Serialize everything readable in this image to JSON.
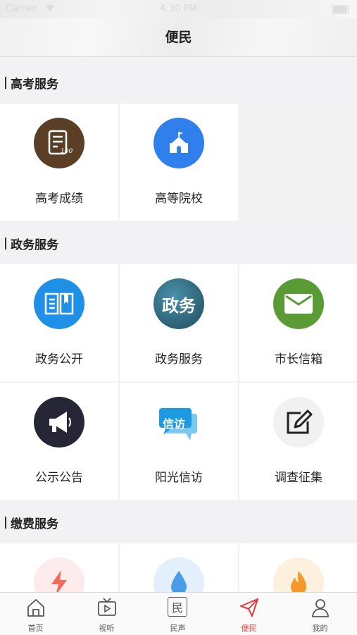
{
  "status_bar": {
    "carrier": "Carrier",
    "time": "4:30 PM"
  },
  "nav": {
    "title": "便民"
  },
  "sections": [
    {
      "title": "高考服务",
      "items": [
        {
          "label": "高考成绩",
          "icon": "exam-score-icon",
          "color": "#5b3e26"
        },
        {
          "label": "高等院校",
          "icon": "university-icon",
          "color": "#2f80ed"
        }
      ]
    },
    {
      "title": "政务服务",
      "items": [
        {
          "label": "政务公开",
          "icon": "open-book-icon",
          "color": "#1e90e8"
        },
        {
          "label": "政务服务",
          "icon": "gov-service-icon",
          "color": "#2f6f86",
          "text": "政务"
        },
        {
          "label": "市长信箱",
          "icon": "mail-icon",
          "color": "#5a9b36"
        },
        {
          "label": "公示公告",
          "icon": "megaphone-icon",
          "color": "#262636"
        },
        {
          "label": "阳光信访",
          "icon": "petition-chat-icon",
          "color": "#1e9be0",
          "text": "信访"
        },
        {
          "label": "调查征集",
          "icon": "edit-survey-icon",
          "color": "#f1f1f1"
        }
      ]
    },
    {
      "title": "缴费服务",
      "items": [
        {
          "label": "",
          "icon": "electricity-icon",
          "color": "#fdeaea"
        },
        {
          "label": "",
          "icon": "water-drop-icon",
          "color": "#e3effc"
        },
        {
          "label": "",
          "icon": "gas-flame-icon",
          "color": "#fdf0df"
        }
      ]
    }
  ],
  "tabbar": {
    "items": [
      {
        "label": "首页",
        "icon": "home-icon"
      },
      {
        "label": "视听",
        "icon": "tv-icon"
      },
      {
        "label": "民声",
        "icon": "voice-icon",
        "text": "民"
      },
      {
        "label": "便民",
        "icon": "send-icon",
        "active": true
      },
      {
        "label": "我的",
        "icon": "user-icon"
      }
    ],
    "active_color": "#e23a3a"
  }
}
